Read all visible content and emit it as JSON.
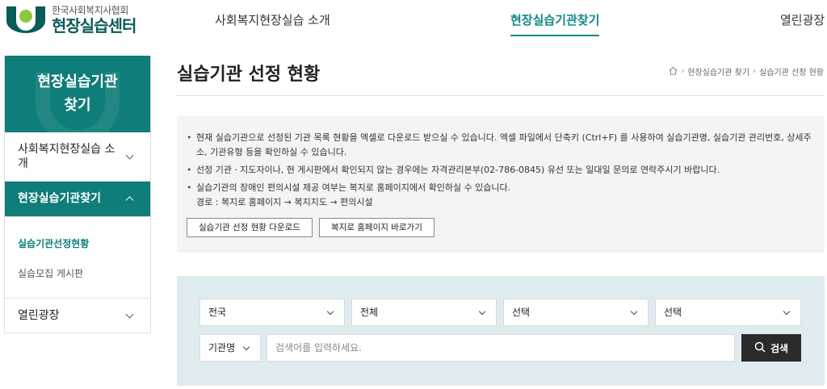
{
  "logo": {
    "org": "한국사회복지사협회",
    "name": "현장실습센터"
  },
  "gnb": [
    {
      "label": "사회복지현장실습 소개"
    },
    {
      "label": "현장실습기관찾기"
    },
    {
      "label": "열린광장"
    }
  ],
  "sidebar": {
    "title": "현장실습기관\n찾기",
    "menu1": "사회복지현장실습 소개",
    "menu2": "현장실습기관찾기",
    "sub": [
      "실습기관선정현황",
      "실습모집 게시판"
    ],
    "menu3": "열린광장"
  },
  "page": {
    "title": "실습기관 선정 현황",
    "breadcrumb": [
      "현장실습기관 찾기",
      "실습기관 선정 현황"
    ]
  },
  "info": {
    "items": [
      "현재 실습기관으로 선정된 기관 목록 현황을 엑셀로 다운로드 받으실 수 있습니다. 엑셀 파일에서 단축키 (Ctrl+F) 를 사용하여 실습기관명, 실습기관 관리번호, 상세주소, 기관유형 등을 확인하실 수 있습니다.",
      "선정 기관ㆍ지도자이나, 현 게시판에서 확인되지 않는 경우에는 자격관리본부(02-786-0845) 유선 또는 일대일 문의로 연락주시기 바랍니다.",
      "실습기관의 장애인 편의시설 제공 여부는 복지로 홈페이지에서 확인하실 수 있습니다."
    ],
    "path": "경로 : 복지로 홈페이지 → 복지지도 → 편의시설",
    "btn_download": "실습기관 선정 현황 다운로드",
    "btn_bokjiro": "복지로 홈페이지 바로가기"
  },
  "search": {
    "region": "전국",
    "type": "전체",
    "select3": "선택",
    "select4": "선택",
    "field": "기관명",
    "placeholder": "검색어를 입력하세요.",
    "button": "검색"
  },
  "colors": {
    "accent": "#0f7d79",
    "search_bg": "#dfecef",
    "info_bg": "#f4f4f4"
  }
}
